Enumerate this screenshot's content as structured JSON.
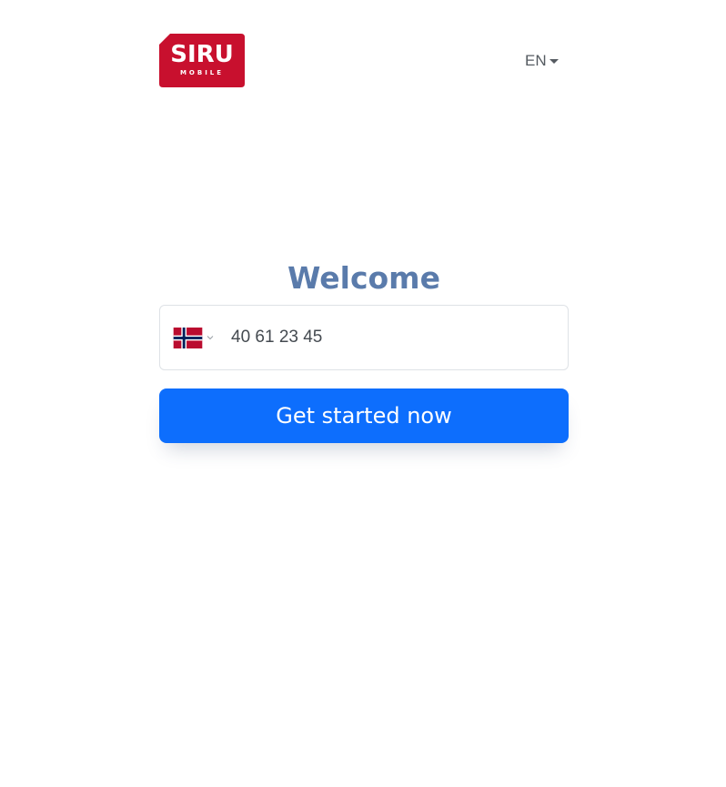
{
  "brand": {
    "logo_text": "SIRU",
    "logo_subtext": "MOBILE",
    "logo_color": "#c8102e"
  },
  "language": {
    "current": "EN"
  },
  "main": {
    "heading": "Welcome",
    "heading_color": "#5a7bab",
    "phone": {
      "country_flag": "norway-flag-icon",
      "value": "40 61 23 45"
    },
    "cta_label": "Get started now",
    "cta_color": "#0d6efd"
  }
}
